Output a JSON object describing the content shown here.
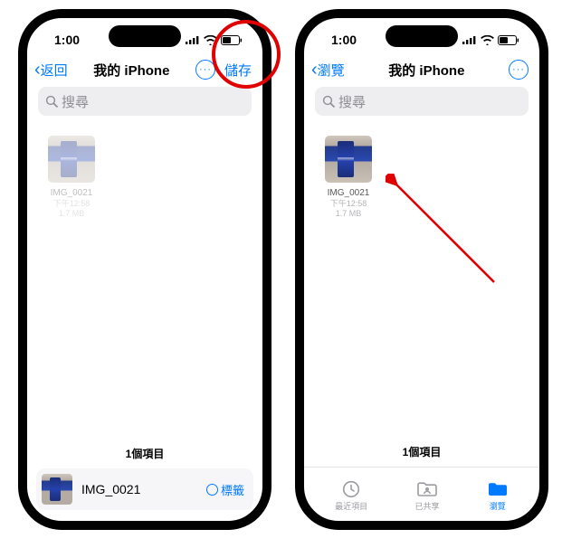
{
  "status": {
    "time": "1:00"
  },
  "left": {
    "nav": {
      "back": "返回",
      "title": "我的 iPhone",
      "save": "儲存"
    },
    "search_placeholder": "搜尋",
    "file": {
      "name": "IMG_0021",
      "time": "下午12:58",
      "size": "1.7 MB"
    },
    "count": "1個項目",
    "save_bar": {
      "name": "IMG_0021",
      "tag": "標籤"
    }
  },
  "right": {
    "nav": {
      "back": "瀏覽",
      "title": "我的 iPhone"
    },
    "search_placeholder": "搜尋",
    "file": {
      "name": "IMG_0021",
      "time": "下午12:58",
      "size": "1.7 MB"
    },
    "count": "1個項目",
    "tabs": {
      "recent": "最近項目",
      "shared": "已共享",
      "browse": "瀏覽"
    }
  }
}
